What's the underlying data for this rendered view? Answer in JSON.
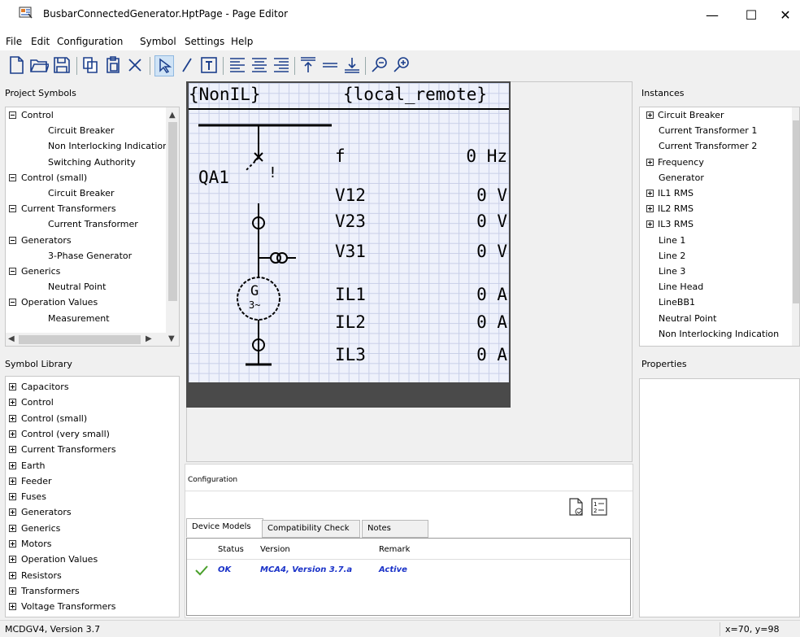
{
  "window": {
    "title": "BusbarConnectedGenerator.HptPage - Page Editor",
    "minimize": "—",
    "maximize": "☐",
    "close": "✕"
  },
  "menu": [
    "File",
    "Edit",
    "Configuration",
    "Symbol",
    "Settings",
    "Help"
  ],
  "toolbar_icons": [
    "new-file-icon",
    "open-folder-icon",
    "save-icon",
    "copy-icon",
    "paste-icon",
    "delete-icon",
    "select-pointer-icon",
    "line-tool-icon",
    "text-tool-icon",
    "align-left-icon",
    "align-center-icon",
    "align-right-icon",
    "align-top-icon",
    "align-middle-icon",
    "align-bottom-icon",
    "zoom-out-icon",
    "zoom-in-icon"
  ],
  "project_symbols": {
    "title": "Project Symbols",
    "items": [
      {
        "label": "Control",
        "level": 0,
        "expanded": true
      },
      {
        "label": "Circuit Breaker",
        "level": 1
      },
      {
        "label": "Non Interlocking Indication",
        "level": 1
      },
      {
        "label": "Switching Authority",
        "level": 1
      },
      {
        "label": "Control (small)",
        "level": 0,
        "expanded": true
      },
      {
        "label": "Circuit Breaker",
        "level": 1
      },
      {
        "label": "Current Transformers",
        "level": 0,
        "expanded": true
      },
      {
        "label": "Current Transformer",
        "level": 1
      },
      {
        "label": "Generators",
        "level": 0,
        "expanded": true
      },
      {
        "label": "3-Phase Generator",
        "level": 1
      },
      {
        "label": "Generics",
        "level": 0,
        "expanded": true
      },
      {
        "label": "Neutral Point",
        "level": 1
      },
      {
        "label": "Operation Values",
        "level": 0,
        "expanded": true
      },
      {
        "label": "Measurement",
        "level": 1
      }
    ]
  },
  "symbol_library": {
    "title": "Symbol Library",
    "items": [
      "Capacitors",
      "Control",
      "Control (small)",
      "Control (very small)",
      "Current Transformers",
      "Earth",
      "Feeder",
      "Fuses",
      "Generators",
      "Generics",
      "Motors",
      "Operation Values",
      "Resistors",
      "Transformers",
      "Voltage Transformers"
    ]
  },
  "lcd": {
    "top_left": "{NonIL}",
    "top_right": "{local_remote}",
    "device_label": "QA1",
    "alarm_mark": "!",
    "rows": [
      {
        "name": "f",
        "value": "0 Hz"
      },
      {
        "name": "V12",
        "value": "0 V"
      },
      {
        "name": "V23",
        "value": "0 V"
      },
      {
        "name": "V31",
        "value": "0 V"
      },
      {
        "name": "IL1",
        "value": "0 A"
      },
      {
        "name": "IL2",
        "value": "0 A"
      },
      {
        "name": "IL3",
        "value": "0 A"
      }
    ],
    "generator_symbol": "G",
    "generator_sub": "3~"
  },
  "configuration": {
    "title": "Configuration",
    "tabs": [
      "Device Models",
      "Compatibility Check",
      "Notes"
    ],
    "columns": [
      "Status",
      "Version",
      "Remark"
    ],
    "rows": [
      {
        "status": "OK",
        "version": "MCA4, Version 3.7.a",
        "remark": "Active"
      }
    ]
  },
  "instances": {
    "title": "Instances",
    "items": [
      {
        "label": "Circuit Breaker",
        "expandable": true
      },
      {
        "label": "Current Transformer 1",
        "expandable": false
      },
      {
        "label": "Current Transformer 2",
        "expandable": false
      },
      {
        "label": "Frequency",
        "expandable": true
      },
      {
        "label": "Generator",
        "expandable": false
      },
      {
        "label": "IL1 RMS",
        "expandable": true
      },
      {
        "label": "IL2 RMS",
        "expandable": true
      },
      {
        "label": "IL3 RMS",
        "expandable": true
      },
      {
        "label": "Line 1",
        "expandable": false
      },
      {
        "label": "Line 2",
        "expandable": false
      },
      {
        "label": "Line 3",
        "expandable": false
      },
      {
        "label": "Line Head",
        "expandable": false
      },
      {
        "label": "LineBB1",
        "expandable": false
      },
      {
        "label": "Neutral Point",
        "expandable": false
      },
      {
        "label": "Non Interlocking Indication",
        "expandable": false
      }
    ]
  },
  "properties": {
    "title": "Properties"
  },
  "status": {
    "left": "MCDGV4, Version 3.7",
    "right": "x=70, y=98"
  },
  "colors": {
    "accent": "#1a32c8",
    "ok_check": "#4aa02c",
    "lcd_bg": "#eef1fb",
    "lcd_frame": "#4a4a4a"
  }
}
